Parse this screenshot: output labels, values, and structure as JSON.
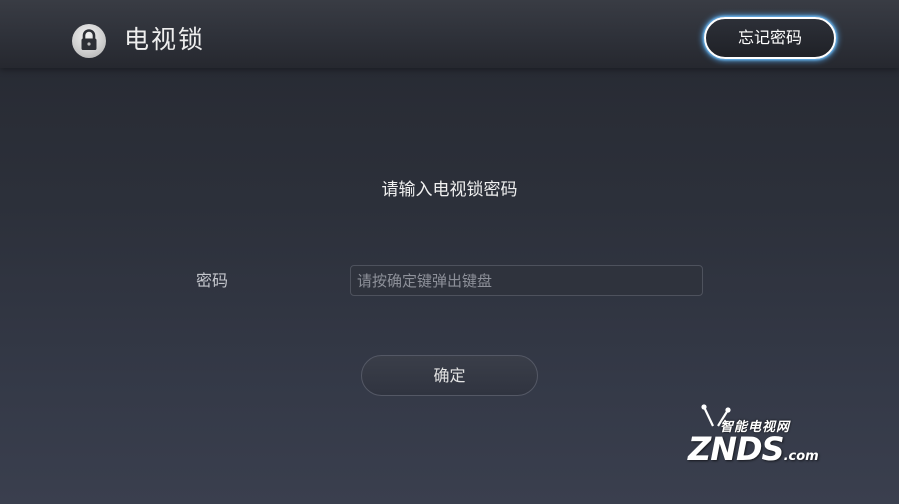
{
  "header": {
    "title": "电视锁",
    "lock_icon": "lock-icon",
    "forgot_label": "忘记密码"
  },
  "main": {
    "prompt": "请输入电视锁密码",
    "password_label": "密码",
    "password_value": "",
    "password_placeholder": "请按确定键弹出键盘",
    "confirm_label": "确定"
  },
  "watermark": {
    "cn_text": "智能电视网",
    "main_text": "ZNDS",
    "domain": ".com"
  },
  "colors": {
    "focus_glow": "#5ab4ff",
    "background": "#2c303a",
    "text_primary": "#f0f0f0"
  }
}
